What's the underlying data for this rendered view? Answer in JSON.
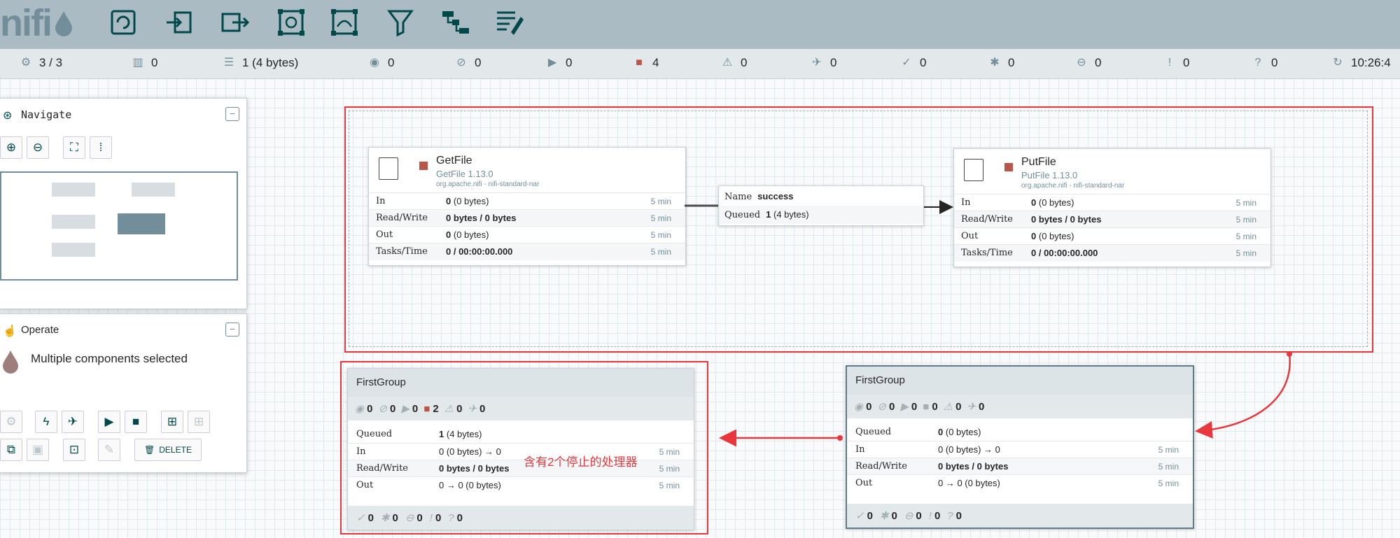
{
  "header": {
    "logo": "nifi",
    "toolbar": [
      "processor-icon",
      "input-port-icon",
      "output-port-icon",
      "process-group-icon",
      "remote-process-group-icon",
      "funnel-icon",
      "template-icon",
      "label-icon"
    ]
  },
  "status_bar": {
    "threads": "3 / 3",
    "tasks": "0",
    "queued": "1 (4 bytes)",
    "transmitting": "0",
    "not_transmitting": "0",
    "running": "0",
    "stopped": "4",
    "invalid": "0",
    "disabled": "0",
    "up_to_date": "0",
    "locally_modified": "0",
    "stale": "0",
    "sync_failure": "0",
    "unknown": "0",
    "time": "10:26:4"
  },
  "navigate": {
    "title": "Navigate"
  },
  "operate": {
    "title": "Operate",
    "selection": "Multiple components selected",
    "delete_label": "DELETE"
  },
  "processors": [
    {
      "name": "GetFile",
      "type": "GetFile 1.13.0",
      "bundle": "org.apache.nifi - nifi-standard-nar",
      "in_count": "0",
      "in_size": "(0 bytes)",
      "read_write": "0 bytes / 0 bytes",
      "out_count": "0",
      "out_size": "(0 bytes)",
      "tasks_time": "0 / 00:00:00.000",
      "window": "5 min",
      "labels": {
        "in": "In",
        "rw": "Read/Write",
        "out": "Out",
        "tasks": "Tasks/Time"
      }
    },
    {
      "name": "PutFile",
      "type": "PutFile 1.13.0",
      "bundle": "org.apache.nifi - nifi-standard-nar",
      "in_count": "0",
      "in_size": "(0 bytes)",
      "read_write": "0 bytes / 0 bytes",
      "out_count": "0",
      "out_size": "(0 bytes)",
      "tasks_time": "0 / 00:00:00.000",
      "window": "5 min",
      "labels": {
        "in": "In",
        "rw": "Read/Write",
        "out": "Out",
        "tasks": "Tasks/Time"
      }
    }
  ],
  "connection": {
    "name_label": "Name",
    "name": "success",
    "queued_label": "Queued",
    "queued_count": "1",
    "queued_size": "(4 bytes)"
  },
  "groups": [
    {
      "title": "FirstGroup",
      "transmitting": "0",
      "not_transmitting": "0",
      "running": "0",
      "stopped": "2",
      "invalid": "0",
      "disabled": "0",
      "queued_label": "Queued",
      "queued_count": "1",
      "queued_size": "(4 bytes)",
      "in_label": "In",
      "in": "0 (0 bytes) → 0",
      "rw_label": "Read/Write",
      "rw": "0 bytes / 0 bytes",
      "out_label": "Out",
      "out": "0 → 0 (0 bytes)",
      "window": "5 min",
      "up_to_date": "0",
      "locally_modified": "0",
      "stale": "0",
      "sync_failure": "0",
      "unknown": "0"
    },
    {
      "title": "FirstGroup",
      "transmitting": "0",
      "not_transmitting": "0",
      "running": "0",
      "stopped": "0",
      "invalid": "0",
      "disabled": "0",
      "queued_label": "Queued",
      "queued_count": "0",
      "queued_size": "(0 bytes)",
      "in_label": "In",
      "in": "0 (0 bytes) → 0",
      "rw_label": "Read/Write",
      "rw": "0 bytes / 0 bytes",
      "out_label": "Out",
      "out": "0 → 0 (0 bytes)",
      "window": "5 min",
      "up_to_date": "0",
      "locally_modified": "0",
      "stale": "0",
      "sync_failure": "0",
      "unknown": "0"
    }
  ],
  "annotation": "含有2个停止的处理器",
  "colors": {
    "accent": "#e8383d",
    "header": "#aabbc3",
    "stopped": "#ba554a",
    "brand": "#728e9b"
  }
}
